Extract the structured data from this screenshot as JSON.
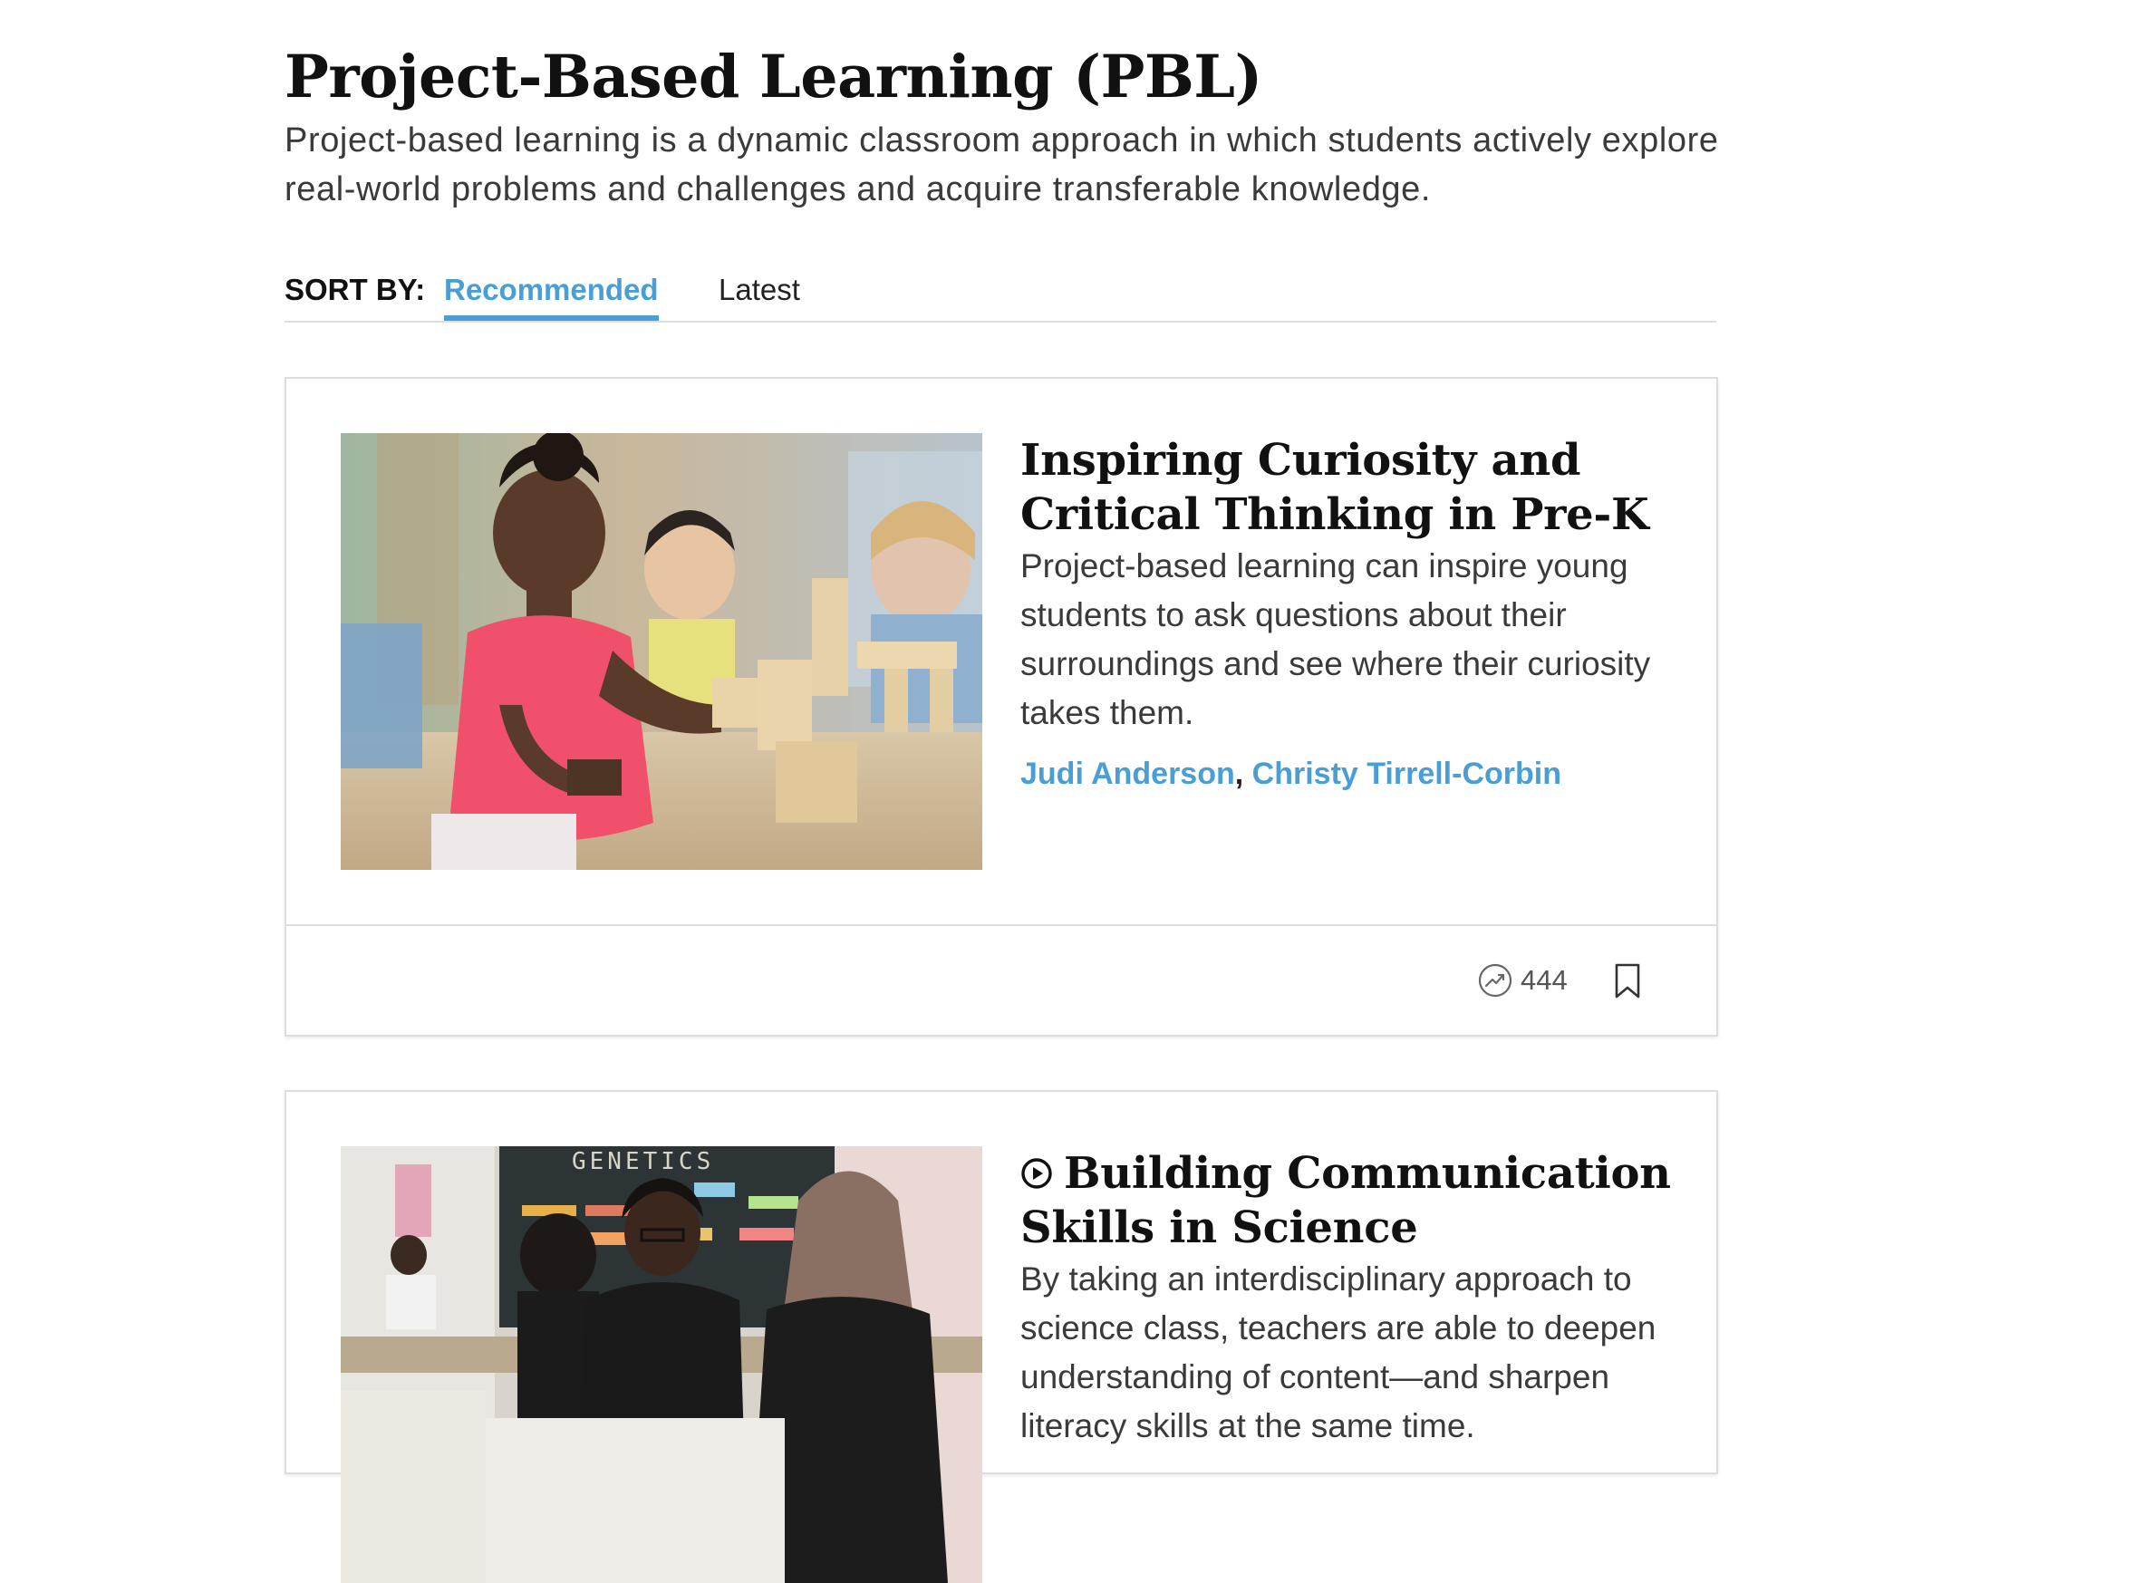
{
  "page": {
    "title": "Project-Based Learning (PBL)",
    "description": "Project-based learning is a dynamic classroom approach in which students actively explore real-world problems and challenges and acquire transferable knowledge."
  },
  "sort": {
    "label": "SORT BY:",
    "options": [
      "Recommended",
      "Latest"
    ],
    "selected": "Recommended"
  },
  "colors": {
    "accent": "#4a9ed6",
    "border": "#dddddd",
    "title": "#111111",
    "body": "#3a3a3a"
  },
  "articles": [
    {
      "title": "Inspiring Curiosity and Critical Thinking in Pre-K",
      "summary": "Project-based learning can inspire young students to ask questions about their surroundings and see where their curiosity takes them.",
      "authors": [
        "Judi Anderson",
        "Christy Tirrell-Corbin"
      ],
      "author_separator": ",",
      "trending_count": "444",
      "icons": {
        "trending": "trending-up-icon",
        "bookmark": "bookmark-icon"
      }
    },
    {
      "title": "Building Communication Skills in Science",
      "summary": "By taking an interdisciplinary approach to science class, teachers are able to deepen understanding of content—and sharpen literacy skills at the same time.",
      "icons": {
        "media": "play-circle-icon"
      }
    }
  ]
}
